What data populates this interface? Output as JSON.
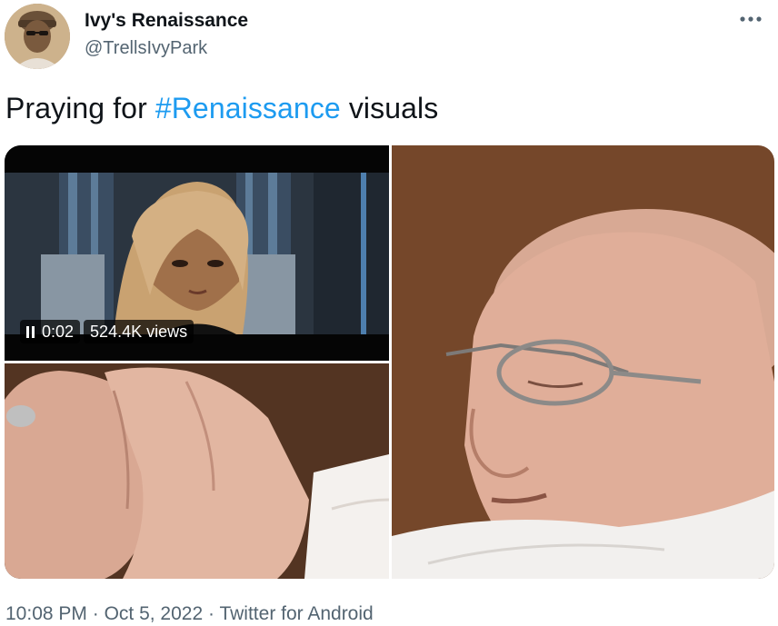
{
  "author": {
    "display_name": "Ivy's Renaissance",
    "handle": "@TrellsIvyPark"
  },
  "tweet": {
    "text_before": "Praying for ",
    "hashtag": "#Renaissance",
    "text_after": " visuals"
  },
  "media": {
    "video": {
      "time": "0:02",
      "views": "524.4K views"
    }
  },
  "meta": {
    "time": "10:08 PM",
    "separator": "·",
    "date": "Oct 5, 2022",
    "source": "Twitter for Android"
  },
  "colors": {
    "link": "#1d9bf0",
    "secondary_text": "#536471",
    "primary_text": "#0f1419"
  },
  "icons": {
    "more": "more-horizontal-icon",
    "pause": "pause-icon"
  }
}
